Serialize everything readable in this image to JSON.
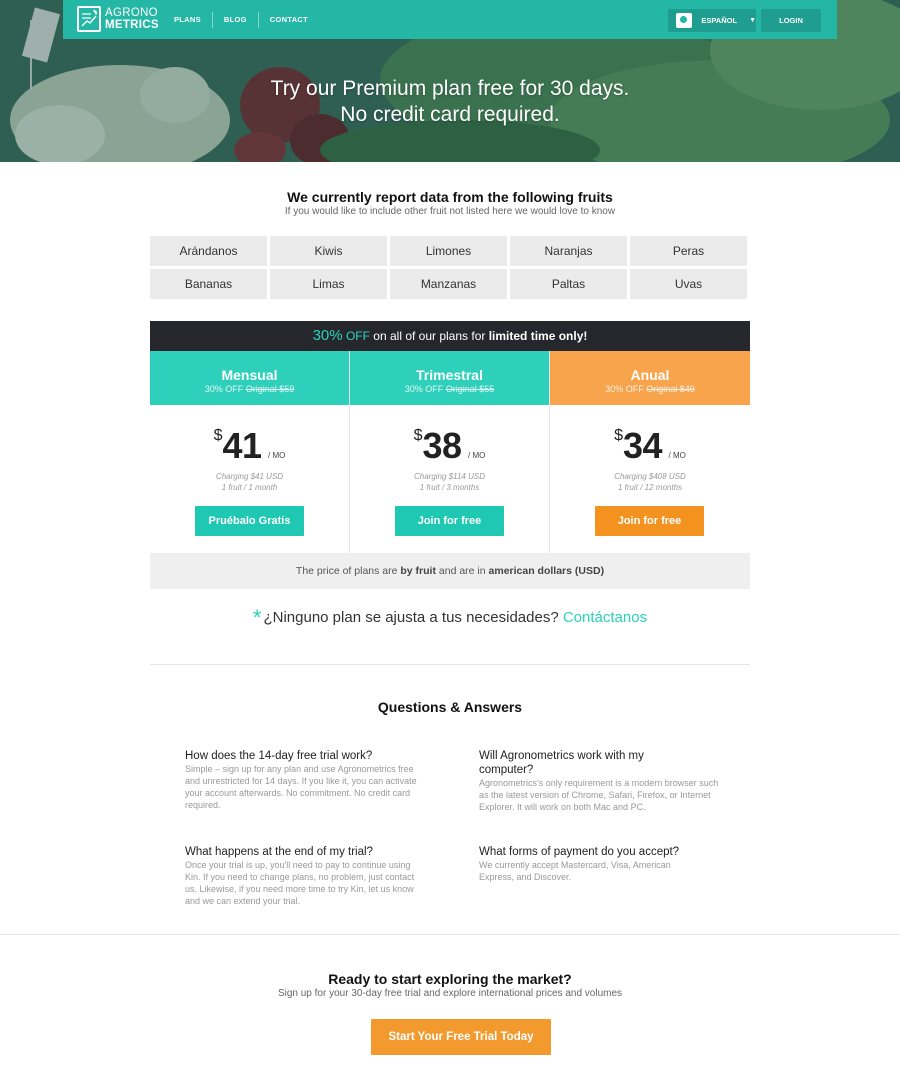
{
  "nav": {
    "logo_line1": "AGRONO",
    "logo_line2": "METRICS",
    "links": [
      "PLANS",
      "BLOG",
      "CONTACT"
    ],
    "language": "ESPAÑOL",
    "login": "LOGIN",
    "color": "#25b7a6"
  },
  "hero": {
    "line1": "Try our Premium plan free for 30 days.",
    "line2": "No credit card required."
  },
  "fruits": {
    "title": "We currently report data from the following fruits",
    "subtitle": "If you would like to include other fruit not listed here we would love to know",
    "items": [
      "Arándanos",
      "Kiwis",
      "Limones",
      "Naranjas",
      "Peras",
      "Bananas",
      "Limas",
      "Manzanas",
      "Paltas",
      "Uvas"
    ]
  },
  "promo": {
    "percent": "30%",
    "off": "OFF",
    "middle": " on all of our plans for ",
    "strong": "limited time only!"
  },
  "plans": [
    {
      "name": "Mensual",
      "discount_prefix": "30% OFF ",
      "original": "Original $59",
      "currency": "$",
      "amount": "41",
      "unit": "/ MO",
      "charge1": "Charging $41 USD",
      "charge2": "1 fruit / 1 month",
      "button": "Pruébalo Gratis",
      "color": "#2fd0bb",
      "button_color": "#1fc8b3"
    },
    {
      "name": "Trimestral",
      "discount_prefix": "30% OFF ",
      "original": "Original $55",
      "currency": "$",
      "amount": "38",
      "unit": "/ MO",
      "charge1": "Charging $114 USD",
      "charge2": "1 fruit / 3 months",
      "button": "Join for free",
      "color": "#2fd0bb",
      "button_color": "#1fc8b3"
    },
    {
      "name": "Anual",
      "discount_prefix": "30% OFF ",
      "original": "Original $49",
      "currency": "$",
      "amount": "34",
      "unit": "/ MO",
      "charge1": "Charging $408 USD",
      "charge2": "1 fruit / 12 months",
      "button": "Join for free",
      "color": "#f7a44c",
      "button_color": "#f3921f"
    }
  ],
  "price_note": {
    "prefix": "The price of plans are ",
    "by": "by fruit",
    "middle": " and are in ",
    "currency": "american dollars (USD)"
  },
  "contact": {
    "star": "*",
    "question": "¿Ninguno plan se ajusta a tus necesidades? ",
    "link": "Contáctanos"
  },
  "faq": {
    "title": "Questions & Answers",
    "items": [
      {
        "q": "How does the 14-day free trial work?",
        "a": "Simple – sign up for any plan and use Agronometrics free and unrestricted for 14 days. If you like it, you can activate your account afterwards. No commitment. No credit card required."
      },
      {
        "q": "Will Agronometrics work with my computer?",
        "a": "Agronometrics's only requirement is a modern browser such as the latest version of Chrome, Safari, Firefox, or Internet Explorer. It will work on both Mac and PC."
      },
      {
        "q": "What happens at the end of my trial?",
        "a": "Once your trial is up, you'll need to pay to continue using Kin. If you need to change plans, no problem, just contact us. Likewise, if you need more time to try Kin, let us know and we can extend your trial."
      },
      {
        "q": "What forms of payment do you accept?",
        "a": "We currently accept Mastercard, Visa, American Express, and Discover."
      }
    ]
  },
  "cta": {
    "title": "Ready to start exploring the market?",
    "subtitle": "Sign up for your 30-day free trial and explore international prices and volumes",
    "button": "Start Your Free Trial Today"
  }
}
